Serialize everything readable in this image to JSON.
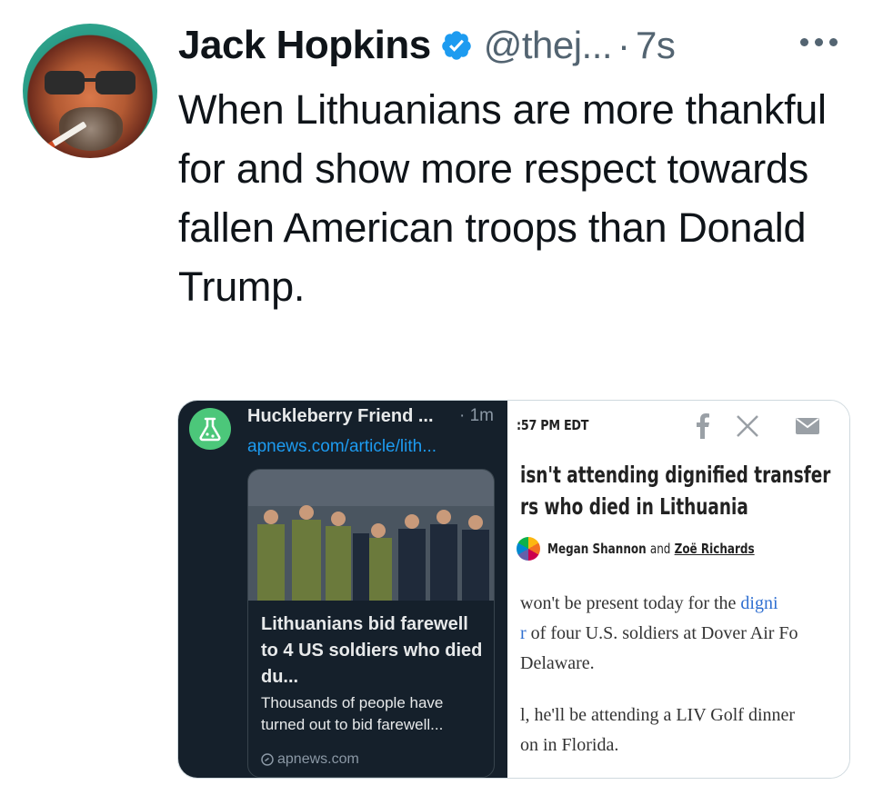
{
  "tweet": {
    "display_name": "Jack Hopkins",
    "handle": "@thej...",
    "separator": "·",
    "time": "7s",
    "text": "When Lithuanians are more thankful for and show more respect towards fallen American troops than Donald Trump.",
    "verified_color": "#1d9bf0"
  },
  "embedded": {
    "left": {
      "account_name": "Huckleberry Friend ...",
      "time": "· 1m",
      "link": "apnews.com/article/lith...",
      "card_title": "Lithuanians bid farewell to 4 US soldiers who died du...",
      "card_desc": "Thousands of people have turned out to bid farewell...",
      "card_source": "apnews.com"
    },
    "right": {
      "time": ":57 PM EDT",
      "headline_line1": "isn't attending dignified transfer",
      "headline_line2": "rs who died in Lithuania",
      "author1": "Megan Shannon",
      "author_and": "and",
      "author2": "Zoë Richards",
      "body_line1_a": "won't be present today for the ",
      "body_line1_b": "digni",
      "body_line2_a": "r",
      "body_line2_b": " of four U.S. soldiers at Dover Air Fo",
      "body_line3": "Delaware.",
      "body_line4": "l, he'll be attending a LIV Golf dinner",
      "body_line5": "on in Florida."
    }
  }
}
